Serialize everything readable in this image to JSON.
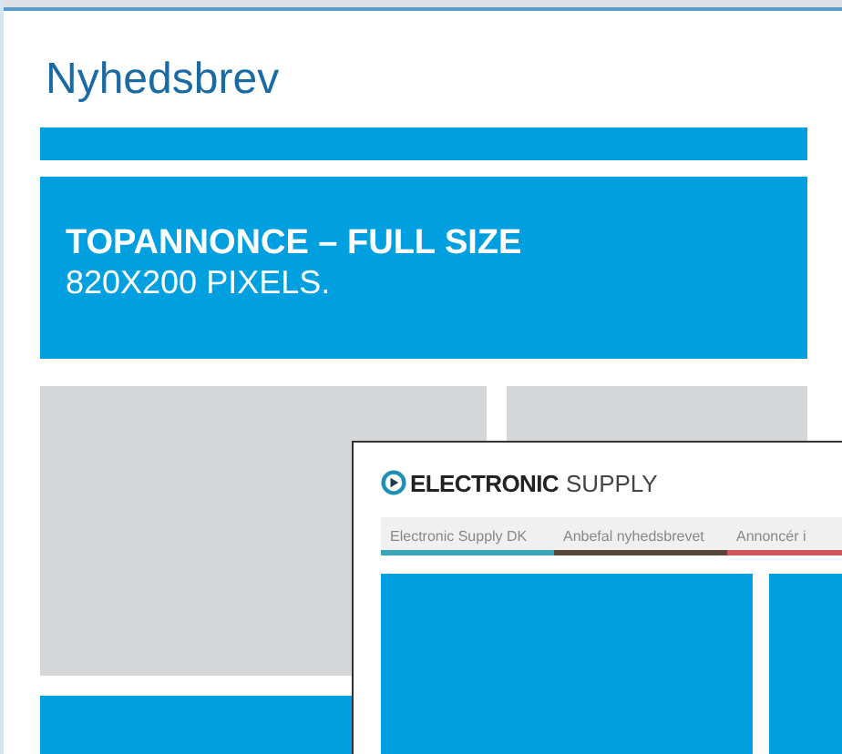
{
  "title": "Nyhedsbrev",
  "top_banner": {
    "heading": "TOPANNONCE – FULL SIZE",
    "size": "820X200 PIXELS."
  },
  "preview": {
    "logo_bold": "ELECTRONIC",
    "logo_light": "SUPPLY",
    "tabs": [
      {
        "label": "Electronic Supply DK",
        "color": "#3aa7b8"
      },
      {
        "label": "Anbefal nyhedsbrevet",
        "color": "#5a4638"
      },
      {
        "label": "Annoncér i",
        "color": "#d0555c"
      }
    ]
  }
}
